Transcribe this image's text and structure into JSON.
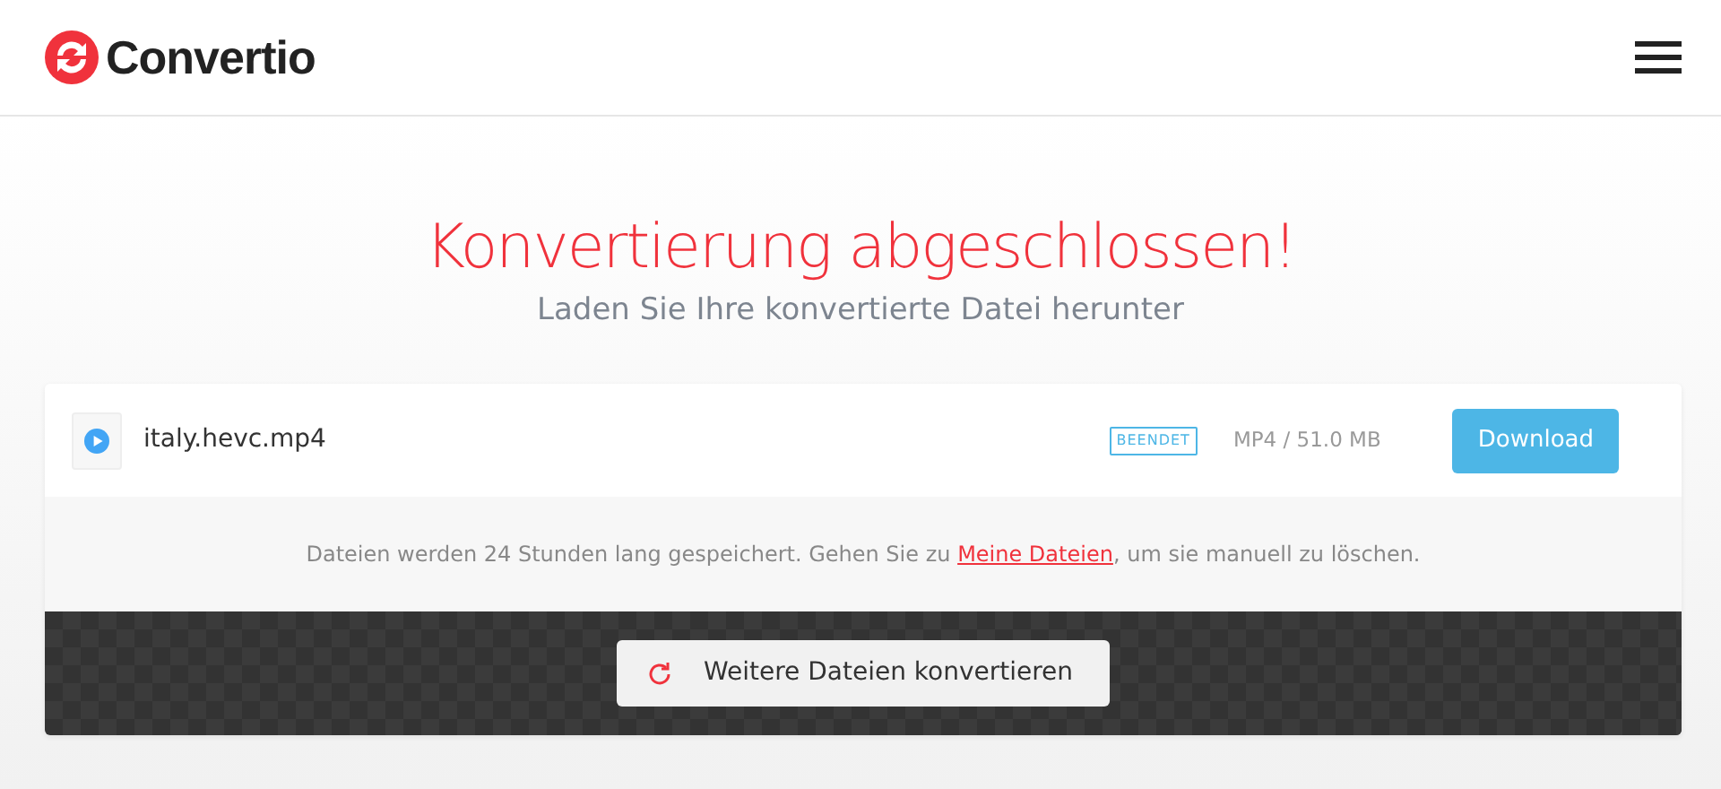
{
  "header": {
    "brand": "Convertio"
  },
  "heading": {
    "title": "Konvertierung abgeschlossen!",
    "subtitle": "Laden Sie Ihre konvertierte Datei herunter"
  },
  "file": {
    "name": "italy.hevc.mp4",
    "status": "BEENDET",
    "info": "MP4 / 51.0 MB",
    "button": "Download"
  },
  "notice": {
    "before": "Dateien werden 24 Stunden lang gespeichert. Gehen Sie zu ",
    "link": "Meine Dateien",
    "after": ", um sie manuell zu löschen."
  },
  "convert_button": "Weitere Dateien konvertieren"
}
